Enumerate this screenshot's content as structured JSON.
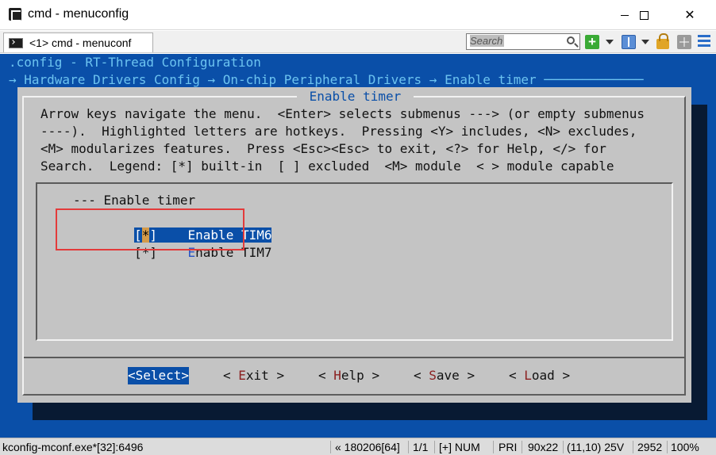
{
  "window": {
    "title": "cmd - menuconfig",
    "tab_label": "<1> cmd - menuconf",
    "search_placeholder": "Search",
    "colors": {
      "console_bg": "#0a4fa8",
      "dialog_bg": "#c4c4c4",
      "highlight_box": "#e33b3b"
    },
    "icons": [
      "console-icon",
      "minimize-icon",
      "maximize-icon",
      "close-icon",
      "tab-console-icon",
      "search-icon",
      "add-console-icon",
      "dropdown-icon",
      "split-icon",
      "lock-icon",
      "grid-icon",
      "hamburger-menu-icon"
    ]
  },
  "console": {
    "config_line": ".config - RT-Thread Configuration",
    "breadcrumb_line": "→ Hardware Drivers Config → On-chip Peripheral Drivers → Enable timer ─────────────"
  },
  "dialog": {
    "title": " Enable timer ",
    "help_text": "Arrow keys navigate the menu.  <Enter> selects submenus ---> (or empty submenus\n----).  Highlighted letters are hotkeys.  Pressing <Y> includes, <N> excludes,\n<M> modularizes features.  Press <Esc><Esc> to exit, <?> for Help, </> for\nSearch.  Legend: [*] built-in  [ ] excluded  <M> module  < > module capable",
    "menu_header": "--- Enable timer",
    "items": [
      {
        "open": "[",
        "mark": "*",
        "close": "]",
        "hotkey": "E",
        "rest": "nable TIM6",
        "selected": true
      },
      {
        "open": "[",
        "mark": "*",
        "close": "]",
        "hotkey": "E",
        "rest": "nable TIM7",
        "selected": false
      }
    ],
    "buttons": {
      "select": "<Select>",
      "exit_pre": "< ",
      "exit_key": "E",
      "exit_post": "xit >",
      "help_pre": "< ",
      "help_key": "H",
      "help_post": "elp >",
      "save_pre": "< ",
      "save_key": "S",
      "save_post": "ave >",
      "load_pre": "< ",
      "load_key": "L",
      "load_post": "oad >"
    }
  },
  "statusbar": {
    "process": "kconfig-mconf.exe*[32]:6496",
    "build": "« 180206[64]",
    "tab_pos": "1/1",
    "mode": "[+] NUM",
    "priority": "PRI",
    "size": "90x22",
    "cursor": "(11,10) 25V",
    "pid": "2952",
    "zoom": "100%"
  }
}
